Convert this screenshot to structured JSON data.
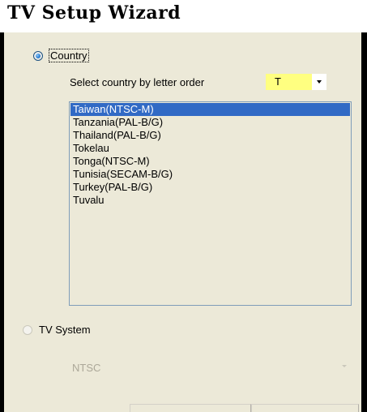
{
  "window": {
    "title": "TV Setup Wizard"
  },
  "country_option": {
    "label": "Country",
    "selected": true
  },
  "letter_filter": {
    "label": "Select country by letter order",
    "value": "T",
    "highlight_color": "#ffff80"
  },
  "country_list": {
    "selected_color": "#316ac5",
    "items": [
      "Taiwan(NTSC-M)",
      "Tanzania(PAL-B/G)",
      "Thailand(PAL-B/G)",
      "Tokelau",
      "Tonga(NTSC-M)",
      "Tunisia(SECAM-B/G)",
      "Turkey(PAL-B/G)",
      "Tuvalu"
    ],
    "selected_index": 0
  },
  "tv_system_option": {
    "label": "TV System",
    "selected": false,
    "enabled": false
  },
  "tv_system_select": {
    "value": "NTSC",
    "enabled": false
  },
  "icons": {
    "dropdown": "chevron-down-icon"
  }
}
